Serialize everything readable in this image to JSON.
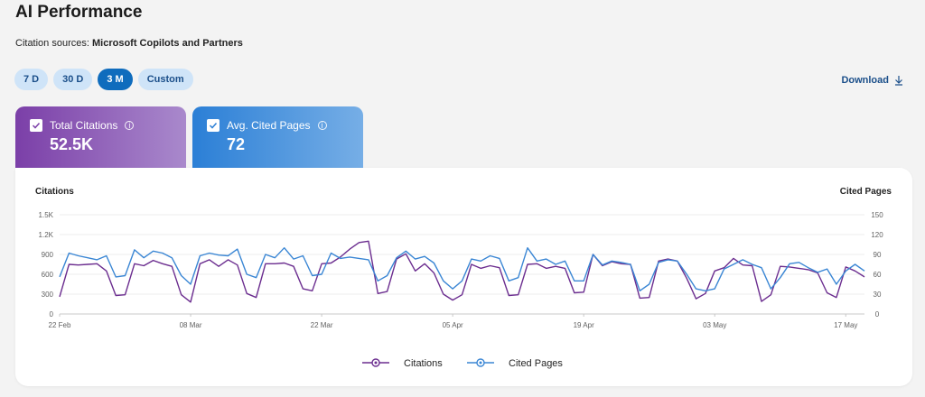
{
  "header": {
    "title": "AI Performance",
    "subtitle_label": "Citation sources: ",
    "subtitle_value": "Microsoft Copilots and Partners"
  },
  "range_buttons": [
    {
      "label": "7 D",
      "active": false
    },
    {
      "label": "30 D",
      "active": false
    },
    {
      "label": "3 M",
      "active": true
    },
    {
      "label": "Custom",
      "active": false
    }
  ],
  "download": {
    "label": "Download",
    "icon": "download-icon"
  },
  "metrics": {
    "citations": {
      "label": "Total Citations",
      "value": "52.5K",
      "checked": true
    },
    "pages": {
      "label": "Avg. Cited Pages",
      "value": "72",
      "checked": true
    }
  },
  "colors": {
    "citations": "#6b2d8f",
    "cited_pages": "#3a86d4",
    "accent": "#0f6cbd"
  },
  "chart_data": {
    "type": "line",
    "left_axis_title": "Citations",
    "right_axis_title": "Cited Pages",
    "left_ticks": [
      "0",
      "300",
      "600",
      "900",
      "1.2K",
      "1.5K"
    ],
    "left_ylim": [
      0,
      1500
    ],
    "right_ticks": [
      "0",
      "30",
      "60",
      "90",
      "120",
      "150"
    ],
    "right_ylim": [
      0,
      150
    ],
    "x_ticks": [
      {
        "label": "22 Feb",
        "index": 0
      },
      {
        "label": "08 Mar",
        "index": 14
      },
      {
        "label": "22 Mar",
        "index": 28
      },
      {
        "label": "05 Apr",
        "index": 42
      },
      {
        "label": "19 Apr",
        "index": 56
      },
      {
        "label": "03 May",
        "index": 70
      },
      {
        "label": "17 May",
        "index": 84
      }
    ],
    "grid": true,
    "legend_position": "bottom-center",
    "series": [
      {
        "name": "Citations",
        "axis": "left",
        "values": [
          260,
          750,
          740,
          750,
          760,
          650,
          280,
          290,
          760,
          730,
          810,
          760,
          720,
          290,
          180,
          760,
          820,
          720,
          820,
          740,
          310,
          250,
          760,
          760,
          770,
          720,
          380,
          350,
          760,
          770,
          860,
          980,
          1080,
          1100,
          310,
          340,
          830,
          910,
          650,
          760,
          620,
          300,
          210,
          290,
          750,
          690,
          730,
          700,
          280,
          290,
          750,
          760,
          690,
          720,
          690,
          320,
          330,
          900,
          730,
          790,
          760,
          750,
          240,
          250,
          800,
          830,
          800,
          540,
          230,
          310,
          650,
          700,
          840,
          740,
          730,
          190,
          290,
          720,
          710,
          690,
          670,
          620,
          320,
          250,
          710,
          650,
          560
        ]
      },
      {
        "name": "Cited Pages",
        "axis": "right",
        "values": [
          56,
          92,
          88,
          85,
          82,
          88,
          56,
          58,
          97,
          85,
          95,
          92,
          85,
          58,
          45,
          88,
          92,
          89,
          88,
          98,
          60,
          55,
          90,
          85,
          100,
          83,
          88,
          58,
          60,
          92,
          84,
          86,
          84,
          82,
          50,
          58,
          85,
          95,
          83,
          87,
          77,
          50,
          38,
          50,
          83,
          80,
          88,
          84,
          50,
          55,
          100,
          80,
          83,
          75,
          80,
          50,
          50,
          90,
          74,
          80,
          78,
          75,
          35,
          45,
          78,
          82,
          80,
          60,
          38,
          35,
          38,
          68,
          75,
          82,
          75,
          70,
          38,
          55,
          76,
          78,
          70,
          63,
          68,
          45,
          65,
          75,
          65
        ]
      }
    ]
  }
}
